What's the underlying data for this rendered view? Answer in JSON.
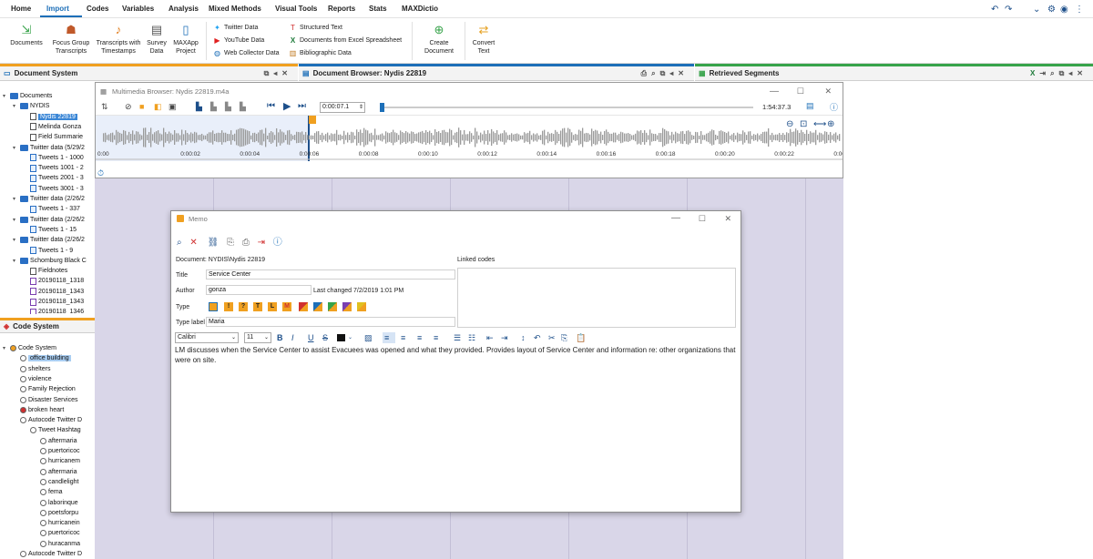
{
  "menu": {
    "items": [
      "Home",
      "Import",
      "Codes",
      "Variables",
      "Analysis",
      "Mixed Methods",
      "Visual Tools",
      "Reports",
      "Stats",
      "MAXDictio"
    ],
    "active": "Import"
  },
  "ribbon": {
    "documents": "Documents",
    "focus_group": "Focus Group\nTranscripts",
    "transcripts": "Transcripts with\nTimestamps",
    "survey": "Survey\nData",
    "maxapp": "MAXApp\nProject",
    "twitter": "Twitter Data",
    "youtube": "YouTube Data",
    "web_collector": "Web Collector Data",
    "structured": "Structured Text",
    "excel": "Documents from Excel Spreadsheet",
    "biblio": "Bibliographic Data",
    "create_doc": "Create\nDocument",
    "convert_text": "Convert\nText"
  },
  "panes": {
    "document_system": "Document System",
    "document_browser": "Document Browser: Nydis 22819",
    "retrieved_segments": "Retrieved Segments",
    "code_system": "Code System"
  },
  "doc_tree": [
    {
      "label": "Documents",
      "indent": 0,
      "type": "folder"
    },
    {
      "label": "NYDIS",
      "indent": 1,
      "type": "folder"
    },
    {
      "label": "Nydis 22819",
      "indent": 2,
      "type": "doc",
      "selected": true
    },
    {
      "label": "Melinda Gonza",
      "indent": 2,
      "type": "doc"
    },
    {
      "label": "Field Summarie",
      "indent": 2,
      "type": "doc"
    },
    {
      "label": "Twitter data (5/29/2",
      "indent": 1,
      "type": "folder"
    },
    {
      "label": "Tweets 1 - 1000",
      "indent": 2,
      "type": "tw"
    },
    {
      "label": "Tweets 1001 - 2",
      "indent": 2,
      "type": "tw"
    },
    {
      "label": "Tweets 2001 - 3",
      "indent": 2,
      "type": "tw"
    },
    {
      "label": "Tweets 3001 - 3",
      "indent": 2,
      "type": "tw"
    },
    {
      "label": "Twitter data (2/26/2",
      "indent": 1,
      "type": "folder"
    },
    {
      "label": "Tweets 1 - 337",
      "indent": 2,
      "type": "tw"
    },
    {
      "label": "Twitter data (2/26/2",
      "indent": 1,
      "type": "folder"
    },
    {
      "label": "Tweets 1 - 15",
      "indent": 2,
      "type": "tw"
    },
    {
      "label": "Twitter data (2/26/2",
      "indent": 1,
      "type": "folder"
    },
    {
      "label": "Tweets 1 - 9",
      "indent": 2,
      "type": "tw"
    },
    {
      "label": "Schomburg Black C",
      "indent": 1,
      "type": "folder"
    },
    {
      "label": "Fieldnotes",
      "indent": 2,
      "type": "doc"
    },
    {
      "label": "20190118_1318",
      "indent": 2,
      "type": "img"
    },
    {
      "label": "20190118_1343",
      "indent": 2,
      "type": "img"
    },
    {
      "label": "20190118_1343",
      "indent": 2,
      "type": "img"
    },
    {
      "label": "20190118_1346",
      "indent": 2,
      "type": "img"
    }
  ],
  "code_tree": [
    {
      "label": "Code System",
      "indent": 0,
      "type": "root"
    },
    {
      "label": "office building",
      "indent": 1,
      "type": "code",
      "selected": true
    },
    {
      "label": "shelters",
      "indent": 1,
      "type": "code"
    },
    {
      "label": "violence",
      "indent": 1,
      "type": "code"
    },
    {
      "label": "Family Rejection",
      "indent": 1,
      "type": "code"
    },
    {
      "label": "Disaster Services",
      "indent": 1,
      "type": "code"
    },
    {
      "label": "broken heart",
      "indent": 1,
      "type": "heart"
    },
    {
      "label": "Autocode Twitter D",
      "indent": 1,
      "type": "code"
    },
    {
      "label": "Tweet Hashtag",
      "indent": 2,
      "type": "code"
    },
    {
      "label": "aftermaria",
      "indent": 3,
      "type": "code"
    },
    {
      "label": "puertoricoc",
      "indent": 3,
      "type": "code"
    },
    {
      "label": "hurricanem",
      "indent": 3,
      "type": "code"
    },
    {
      "label": "aftermaria",
      "indent": 3,
      "type": "code"
    },
    {
      "label": "candlelight",
      "indent": 3,
      "type": "code"
    },
    {
      "label": "fema",
      "indent": 3,
      "type": "code"
    },
    {
      "label": "laborinque",
      "indent": 3,
      "type": "code"
    },
    {
      "label": "poetsforpu",
      "indent": 3,
      "type": "code"
    },
    {
      "label": "hurricanein",
      "indent": 3,
      "type": "code"
    },
    {
      "label": "puertoricoc",
      "indent": 3,
      "type": "code"
    },
    {
      "label": "huracanma",
      "indent": 3,
      "type": "code"
    },
    {
      "label": "Autocode Twitter D",
      "indent": 1,
      "type": "code"
    }
  ],
  "multimedia": {
    "title": "Multimedia Browser:  Nydis 22819.m4a",
    "position": "0:00:07.1",
    "duration": "1:54:37.3",
    "playhead_fraction": 0.001,
    "ticks": [
      "0:00",
      "0:00:02",
      "0:00:04",
      "0:00:06",
      "0:00:08",
      "0:00:10",
      "0:00:12",
      "0:00:14",
      "0:00:16",
      "0:00:18",
      "0:00:20",
      "0:00:22",
      "0:00:24"
    ]
  },
  "memo": {
    "title": "Memo",
    "document_path": "Document: NYDIS\\Nydis 22819",
    "linked_codes_label": "Linked codes",
    "title_label": "Title",
    "title_value": "Service Center",
    "author_label": "Author",
    "author_value": "gonza",
    "last_changed_label": "Last changed",
    "last_changed_value": "7/2/2019 1:01 PM",
    "type_label": "Type",
    "type_label_label": "Type label",
    "type_label_value": "Maria",
    "font": "Calibri",
    "font_size": "11",
    "body": "LM discusses when the Service Center to assist Evacuees was opened and what they provided. Provides layout of Service Center and information re: other organizations that were on site."
  },
  "colors": {
    "accent_blue": "#1d6fb8",
    "selection": "#3a86d6",
    "retrieved_bg": "#d9d6e8",
    "green_accent": "#37a34a",
    "orange_accent": "#f0a020"
  }
}
